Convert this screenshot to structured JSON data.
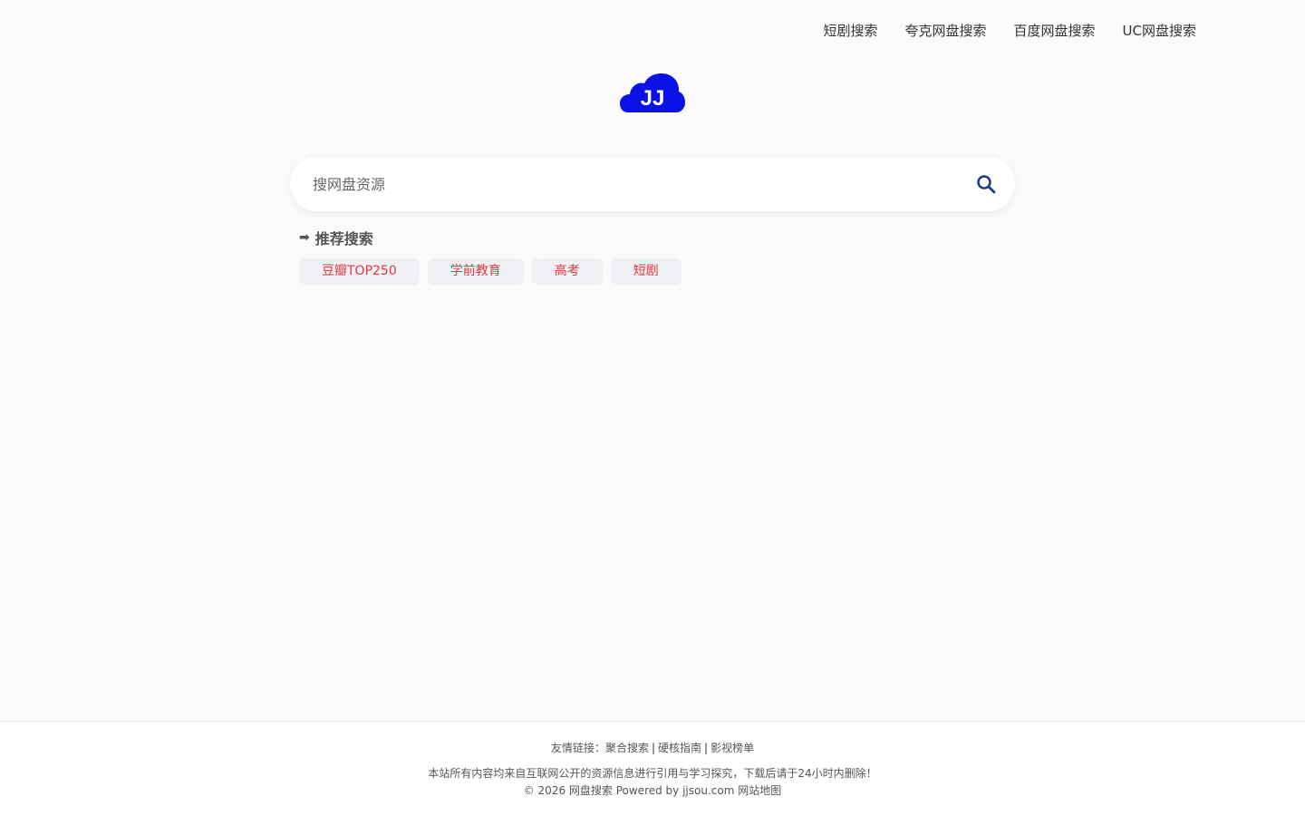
{
  "nav": {
    "items": [
      {
        "label": "短剧搜索"
      },
      {
        "label": "夸克网盘搜索"
      },
      {
        "label": "百度网盘搜索"
      },
      {
        "label": "UC网盘搜索"
      }
    ]
  },
  "logo": {
    "text": "JJ",
    "color": "#0a12e6"
  },
  "search": {
    "placeholder": "搜网盘资源",
    "value": "",
    "icon": "search-icon"
  },
  "recommend": {
    "arrow": "➡",
    "title": "推荐搜索",
    "tags": [
      {
        "label": "豆瓣TOP250"
      },
      {
        "label": "学前教育"
      },
      {
        "label": "高考"
      },
      {
        "label": "短剧"
      }
    ]
  },
  "footer": {
    "friend_links_prefix": "友情链接：",
    "friend_links": [
      {
        "label": "聚合搜索"
      },
      {
        "label": "硬核指南"
      },
      {
        "label": "影视榜单"
      }
    ],
    "separator": "|",
    "disclaimer": "本站所有内容均来自互联网公开的资源信息进行引用与学习探究，下载后请于24小时内删除！",
    "copyright_text": "© 2026 网盘搜索 Powered by jjsou.com",
    "sitemap_label": "网站地图"
  },
  "colors": {
    "accent": "#0a12e6",
    "tag_text": "#e0393e",
    "tag_bg": "#f0f1f5",
    "search_icon": "#1e3a8a",
    "page_bg": "#fafafb"
  }
}
